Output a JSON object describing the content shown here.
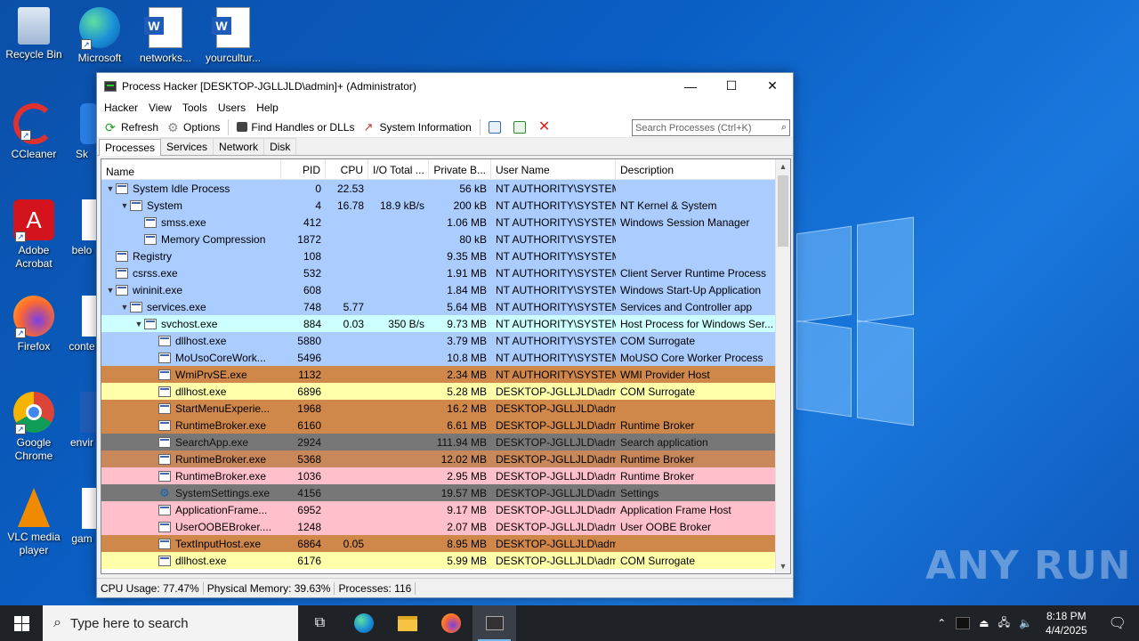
{
  "desktop": {
    "icons": [
      {
        "label": "Recycle Bin"
      },
      {
        "label": "Microsoft Edge"
      },
      {
        "label": "networks..."
      },
      {
        "label": "yourcultur..."
      },
      {
        "label": "CCleaner"
      },
      {
        "label": "Sk"
      },
      {
        "label": "Adobe Acrobat"
      },
      {
        "label": "belo"
      },
      {
        "label": "Firefox"
      },
      {
        "label": "conte"
      },
      {
        "label": "Google Chrome"
      },
      {
        "label": "envir"
      },
      {
        "label": "VLC media player"
      },
      {
        "label": "gam"
      }
    ],
    "watermark": "ANY RUN"
  },
  "window": {
    "title": "Process Hacker [DESKTOP-JGLLJLD\\admin]+ (Administrator)",
    "minimize": "—",
    "maximize": "☐",
    "close": "✕",
    "menu": [
      "Hacker",
      "View",
      "Tools",
      "Users",
      "Help"
    ],
    "toolbar": {
      "refresh": "Refresh",
      "options": "Options",
      "find_handles": "Find Handles or DLLs",
      "system_info": "System Information"
    },
    "search_placeholder": "Search Processes (Ctrl+K)",
    "tabs": [
      "Processes",
      "Services",
      "Network",
      "Disk"
    ],
    "columns": {
      "name": "Name",
      "pid": "PID",
      "cpu": "CPU",
      "io": "I/O Total ...",
      "private": "Private B...",
      "user": "User Name",
      "desc": "Description"
    },
    "rows": [
      {
        "indent": 0,
        "twisty": "v",
        "name": "System Idle Process",
        "pid": "0",
        "cpu": "22.53",
        "io": "",
        "priv": "56 kB",
        "user": "NT AUTHORITY\\SYSTEM",
        "desc": "",
        "color": "#aaccff"
      },
      {
        "indent": 1,
        "twisty": "v",
        "name": "System",
        "pid": "4",
        "cpu": "16.78",
        "io": "18.9 kB/s",
        "priv": "200 kB",
        "user": "NT AUTHORITY\\SYSTEM",
        "desc": "NT Kernel & System",
        "color": "#aaccff"
      },
      {
        "indent": 2,
        "twisty": "",
        "name": "smss.exe",
        "pid": "412",
        "cpu": "",
        "io": "",
        "priv": "1.06 MB",
        "user": "NT AUTHORITY\\SYSTEM",
        "desc": "Windows Session Manager",
        "color": "#aaccff"
      },
      {
        "indent": 2,
        "twisty": "",
        "name": "Memory Compression",
        "pid": "1872",
        "cpu": "",
        "io": "",
        "priv": "80 kB",
        "user": "NT AUTHORITY\\SYSTEM",
        "desc": "",
        "color": "#aaccff"
      },
      {
        "indent": 0,
        "twisty": "",
        "name": "Registry",
        "pid": "108",
        "cpu": "",
        "io": "",
        "priv": "9.35 MB",
        "user": "NT AUTHORITY\\SYSTEM",
        "desc": "",
        "color": "#aaccff"
      },
      {
        "indent": 0,
        "twisty": "",
        "name": "csrss.exe",
        "pid": "532",
        "cpu": "",
        "io": "",
        "priv": "1.91 MB",
        "user": "NT AUTHORITY\\SYSTEM",
        "desc": "Client Server Runtime Process",
        "color": "#aaccff"
      },
      {
        "indent": 0,
        "twisty": "v",
        "name": "wininit.exe",
        "pid": "608",
        "cpu": "",
        "io": "",
        "priv": "1.84 MB",
        "user": "NT AUTHORITY\\SYSTEM",
        "desc": "Windows Start-Up Application",
        "color": "#aaccff"
      },
      {
        "indent": 1,
        "twisty": "v",
        "name": "services.exe",
        "pid": "748",
        "cpu": "5.77",
        "io": "",
        "priv": "5.64 MB",
        "user": "NT AUTHORITY\\SYSTEM",
        "desc": "Services and Controller app",
        "color": "#aaccff"
      },
      {
        "indent": 2,
        "twisty": "v",
        "name": "svchost.exe",
        "pid": "884",
        "cpu": "0.03",
        "io": "350 B/s",
        "priv": "9.73 MB",
        "user": "NT AUTHORITY\\SYSTEM",
        "desc": "Host Process for Windows Ser...",
        "color": "#ccffff"
      },
      {
        "indent": 3,
        "twisty": "",
        "name": "dllhost.exe",
        "pid": "5880",
        "cpu": "",
        "io": "",
        "priv": "3.79 MB",
        "user": "NT AUTHORITY\\SYSTEM",
        "desc": "COM Surrogate",
        "color": "#aaccff"
      },
      {
        "indent": 3,
        "twisty": "",
        "name": "MoUsoCoreWork...",
        "pid": "5496",
        "cpu": "",
        "io": "",
        "priv": "10.8 MB",
        "user": "NT AUTHORITY\\SYSTEM",
        "desc": "MoUSO Core Worker Process",
        "color": "#aaccff"
      },
      {
        "indent": 3,
        "twisty": "",
        "name": "WmiPrvSE.exe",
        "pid": "1132",
        "cpu": "",
        "io": "",
        "priv": "2.34 MB",
        "user": "NT AUTHORITY\\SYSTEM",
        "desc": "WMI Provider Host",
        "color": "#d0884a"
      },
      {
        "indent": 3,
        "twisty": "",
        "name": "dllhost.exe",
        "pid": "6896",
        "cpu": "",
        "io": "",
        "priv": "5.28 MB",
        "user": "DESKTOP-JGLLJLD\\admi",
        "desc": "COM Surrogate",
        "color": "#ffffaa"
      },
      {
        "indent": 3,
        "twisty": "",
        "name": "StartMenuExperie...",
        "pid": "1968",
        "cpu": "",
        "io": "",
        "priv": "16.2 MB",
        "user": "DESKTOP-JGLLJLD\\admi",
        "desc": "",
        "color": "#d0884a"
      },
      {
        "indent": 3,
        "twisty": "",
        "name": "RuntimeBroker.exe",
        "pid": "6160",
        "cpu": "",
        "io": "",
        "priv": "6.61 MB",
        "user": "DESKTOP-JGLLJLD\\admi",
        "desc": "Runtime Broker",
        "color": "#d0884a"
      },
      {
        "indent": 3,
        "twisty": "",
        "name": "SearchApp.exe",
        "pid": "2924",
        "cpu": "",
        "io": "",
        "priv": "111.94 MB",
        "user": "DESKTOP-JGLLJLD\\admi",
        "desc": "Search application",
        "color": "#777777"
      },
      {
        "indent": 3,
        "twisty": "",
        "name": "RuntimeBroker.exe",
        "pid": "5368",
        "cpu": "",
        "io": "",
        "priv": "12.02 MB",
        "user": "DESKTOP-JGLLJLD\\admi",
        "desc": "Runtime Broker",
        "color": "#c9885a"
      },
      {
        "indent": 3,
        "twisty": "",
        "name": "RuntimeBroker.exe",
        "pid": "1036",
        "cpu": "",
        "io": "",
        "priv": "2.95 MB",
        "user": "DESKTOP-JGLLJLD\\admi",
        "desc": "Runtime Broker",
        "color": "#ffc0cb"
      },
      {
        "indent": 3,
        "twisty": "",
        "name": "SystemSettings.exe",
        "pid": "4156",
        "cpu": "",
        "io": "",
        "priv": "19.57 MB",
        "user": "DESKTOP-JGLLJLD\\admi",
        "desc": "Settings",
        "color": "#777777",
        "gear": true
      },
      {
        "indent": 3,
        "twisty": "",
        "name": "ApplicationFrame...",
        "pid": "6952",
        "cpu": "",
        "io": "",
        "priv": "9.17 MB",
        "user": "DESKTOP-JGLLJLD\\admi",
        "desc": "Application Frame Host",
        "color": "#ffc0cb"
      },
      {
        "indent": 3,
        "twisty": "",
        "name": "UserOOBEBroker....",
        "pid": "1248",
        "cpu": "",
        "io": "",
        "priv": "2.07 MB",
        "user": "DESKTOP-JGLLJLD\\admi",
        "desc": "User OOBE Broker",
        "color": "#ffc0cb"
      },
      {
        "indent": 3,
        "twisty": "",
        "name": "TextInputHost.exe",
        "pid": "6864",
        "cpu": "0.05",
        "io": "",
        "priv": "8.95 MB",
        "user": "DESKTOP-JGLLJLD\\admi",
        "desc": "",
        "color": "#d0884a"
      },
      {
        "indent": 3,
        "twisty": "",
        "name": "dllhost.exe",
        "pid": "6176",
        "cpu": "",
        "io": "",
        "priv": "5.99 MB",
        "user": "DESKTOP-JGLLJLD\\admi",
        "desc": "COM Surrogate",
        "color": "#ffffaa"
      }
    ],
    "status": {
      "cpu": "CPU Usage: 77.47%",
      "memory": "Physical Memory: 39.63%",
      "processes": "Processes: 116"
    }
  },
  "taskbar": {
    "search_placeholder": "Type here to search",
    "time": "8:18 PM",
    "date": "4/4/2025"
  }
}
